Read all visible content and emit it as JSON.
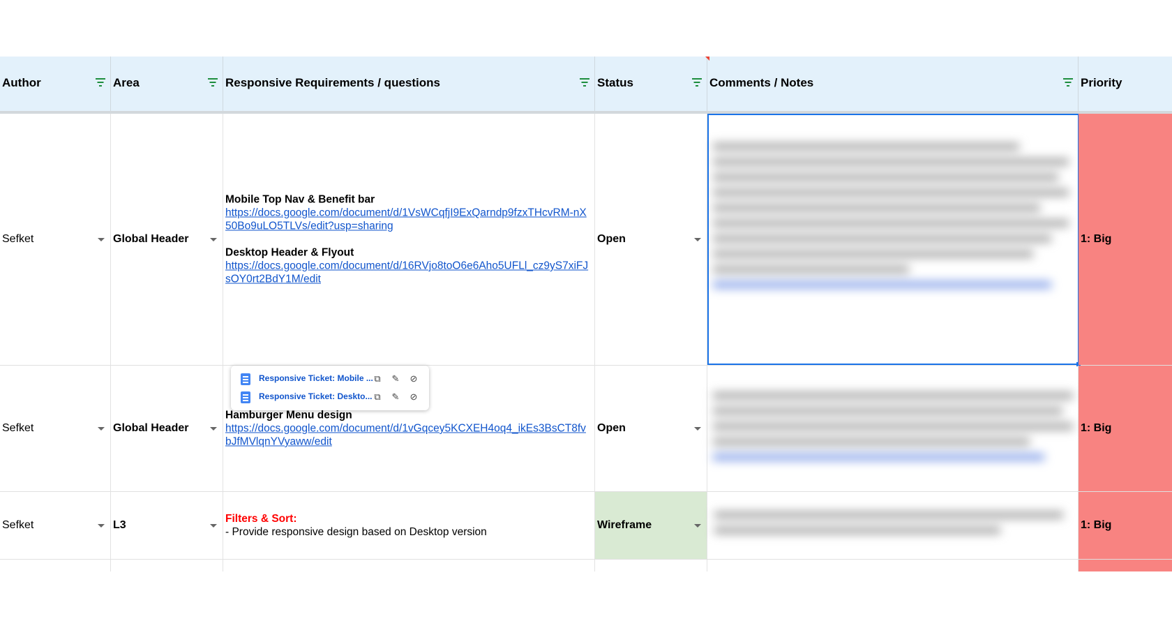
{
  "headers": {
    "author": "Author",
    "area": "Area",
    "requirements": "Responsive Requirements / questions",
    "status": "Status",
    "notes": "Comments / Notes",
    "priority": "Priority"
  },
  "rows": [
    {
      "author": "Sefket",
      "area": "Global Header",
      "req_title_1": "Mobile Top Nav & Benefit bar",
      "req_link_1": "https://docs.google.com/document/d/1VsWCqfjI9ExQarndp9fzxTHcvRM-nX50Bo9uLO5TLVs/edit?usp=sharing",
      "req_title_2": "Desktop Header & Flyout",
      "req_link_2": "https://docs.google.com/document/d/16RVjo8toO6e6Aho5UFLl_cz9yS7xiFJsOY0rt2BdY1M/edit",
      "status": "Open",
      "priority": "1: Big"
    },
    {
      "author": "Sefket",
      "area": "Global Header",
      "req_title_1": "Hamburger Menu design",
      "req_link_1": "https://docs.google.com/document/d/1vGqcey5KCXEH4oq4_ikEs3BsCT8fvbJfMVlqnYVyaww/edit",
      "status": "Open",
      "priority": "1: Big"
    },
    {
      "author": "Sefket",
      "area": "L3",
      "req_title_1": "Filters & Sort:",
      "req_text_1": " - Provide responsive design based on Desktop version",
      "status": "Wireframe",
      "priority": "1: Big"
    }
  ],
  "link_popup": {
    "items": [
      {
        "label": "Responsive Ticket: Mobile ...",
        "icon": "doc-icon"
      },
      {
        "label": "Responsive Ticket: Deskto...",
        "icon": "doc-icon"
      }
    ]
  },
  "colors": {
    "header_bg": "#e3f1fb",
    "priority_big": "#f88381",
    "status_wireframe": "#d9ead3",
    "link": "#1155cc",
    "selection": "#1a73e8"
  }
}
